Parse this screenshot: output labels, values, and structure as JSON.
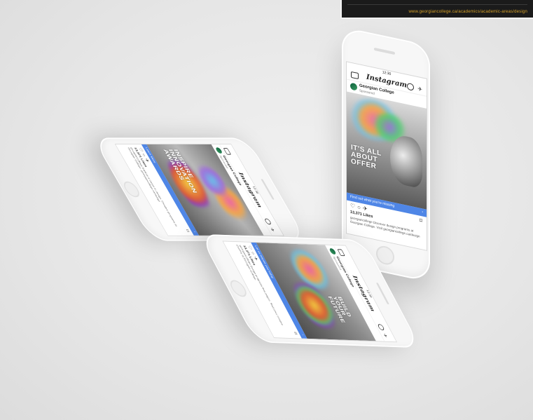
{
  "banner": {
    "url": "www.georgiancollege.ca/academics/academic-areas/design"
  },
  "phones": [
    {
      "id": "phone-left",
      "time": "12:30",
      "app_title": "Instagram",
      "account_name": "Georgian College",
      "account_sub": "Sponsored",
      "photo_text": "INSPIRE INNOVATION AWARDS",
      "cta": "Learn More",
      "likes": "13,371 Likes",
      "caption": "georgiancollege Explore a career in design. Creative programs at Georgian College. georgiancollege.ca/design"
    },
    {
      "id": "phone-right",
      "time": "12:30",
      "app_title": "Instagram",
      "account_name": "Georgian College",
      "account_sub": "Sponsored",
      "photo_text": "IT'S ALL ABOUT OFFER",
      "cta": "Find out what you're missing",
      "likes": "13,371 Likes",
      "caption": "georgiancollege Discover design programs at Georgian College. Visit georgiancollege.ca/design"
    },
    {
      "id": "phone-bottom",
      "time": "12:30",
      "app_title": "Instagram",
      "account_name": "Georgian College",
      "account_sub": "Sponsored",
      "photo_text": "BUILD YOUR FUTURE",
      "cta": "Let us inspire you today",
      "likes": "13,371 Likes",
      "caption": "georgiancollege Design programs that inspire. Start your creative journey at Georgian College."
    }
  ],
  "colors": {
    "cta_blue": "#4f86e6",
    "phone_body": "#f7f7f7",
    "background": "#e9e9e9",
    "banner_bg": "#1b1b1b",
    "banner_url": "#d8a32a"
  }
}
